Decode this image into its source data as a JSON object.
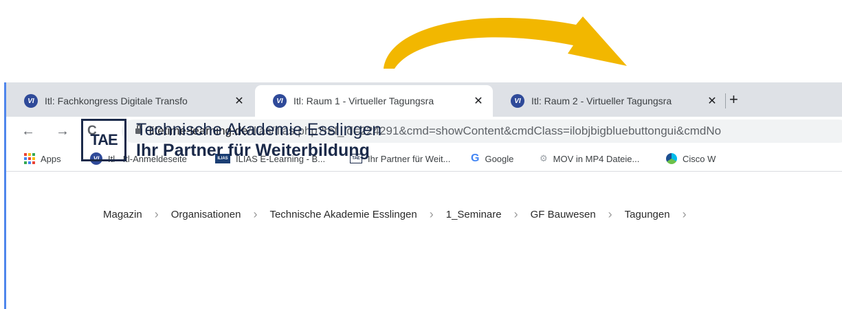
{
  "colors": {
    "arrow": "#f2b700",
    "accent": "#4f86ec",
    "tabstrip": "#dee1e6",
    "brand": "#1b2a4a"
  },
  "tabs": [
    {
      "title": "Itl: Fachkongress Digitale Transfo",
      "close": "✕",
      "icon": "vi-icon",
      "active": false
    },
    {
      "title": "Itl: Raum 1 - Virtueller Tagungsra",
      "close": "✕",
      "icon": "vi-icon",
      "active": true
    },
    {
      "title": "Itl: Raum 2 - Virtueller Tagungsra",
      "close": "✕",
      "icon": "vi-icon",
      "active": false
    }
  ],
  "new_tab": "+",
  "nav": {
    "back": "←",
    "forward": "→",
    "reload": "C"
  },
  "address": {
    "host": "lifetime-learning.de",
    "path": "/ilias/ilias.php?ref_id=224291&cmd=showContent&cmdClass=ilobjbigbluebuttongui&cmdNo"
  },
  "bookmarks": [
    {
      "label": "Apps",
      "icon": "apps-grid-icon"
    },
    {
      "label": "Itl - Itl-Anmeldeseite",
      "icon": "vi-icon"
    },
    {
      "label": "ILIAS E-Learning - B...",
      "icon": "ilias-icon"
    },
    {
      "label": "Ihr Partner für Weit...",
      "icon": "tae-icon"
    },
    {
      "label": "Google",
      "icon": "google-icon"
    },
    {
      "label": "MOV in MP4 Dateie...",
      "icon": "mov-icon"
    },
    {
      "label": "Cisco W",
      "icon": "cisco-icon"
    }
  ],
  "logo": {
    "mark": "TAE",
    "line1": "Technische Akademie Esslingen",
    "line2": "Ihr Partner für Weiterbildung"
  },
  "breadcrumb": [
    "Magazin",
    "Organisationen",
    "Technische Akademie Esslingen",
    "1_Seminare",
    "GF Bauwesen",
    "Tagungen"
  ],
  "breadcrumb_separator": "›"
}
